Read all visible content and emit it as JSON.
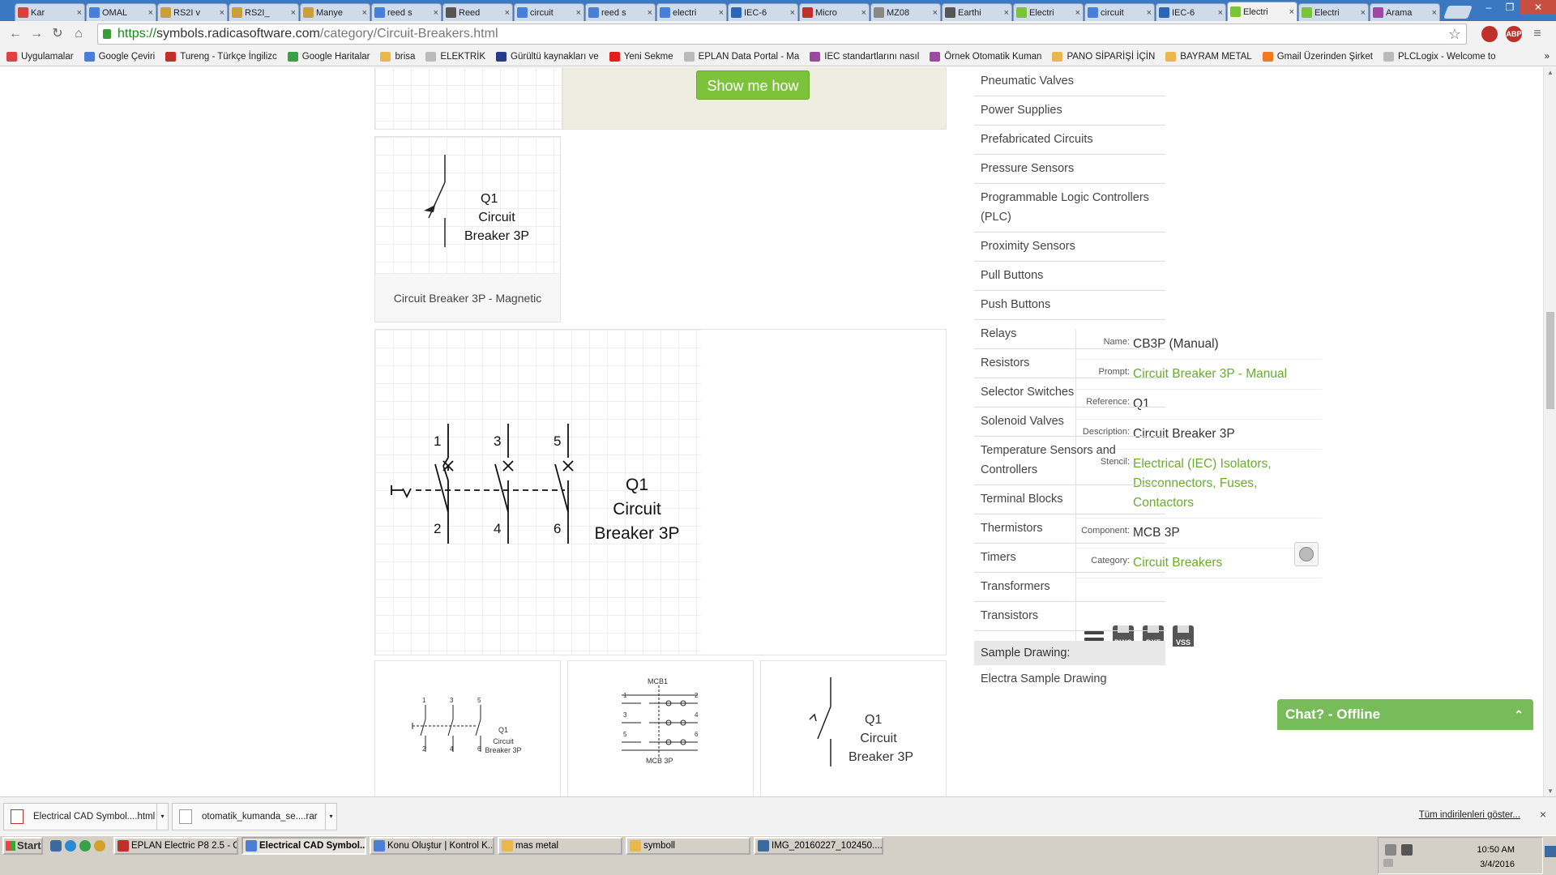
{
  "browser": {
    "tabs": [
      {
        "title": "Kar",
        "icon_color": "#d94040",
        "active": false
      },
      {
        "title": "OMAL",
        "icon_color": "#4a7fd4",
        "active": false
      },
      {
        "title": "RS2I v",
        "icon_color": "#c9a13a",
        "active": false
      },
      {
        "title": "RS2I_",
        "icon_color": "#c9a13a",
        "active": false
      },
      {
        "title": "Manye",
        "icon_color": "#c9a13a",
        "active": false
      },
      {
        "title": "reed s",
        "icon_color": "#4a7fd4",
        "active": false
      },
      {
        "title": "Reed",
        "icon_color": "#555555",
        "active": false
      },
      {
        "title": "circuit",
        "icon_color": "#4a7fd4",
        "active": false
      },
      {
        "title": "reed s",
        "icon_color": "#4a7fd4",
        "active": false
      },
      {
        "title": "electri",
        "icon_color": "#4a7fd4",
        "active": false
      },
      {
        "title": "IEC-6",
        "icon_color": "#2a66b3",
        "active": false
      },
      {
        "title": "Micro",
        "icon_color": "#c0302a",
        "active": false
      },
      {
        "title": "MZ08",
        "icon_color": "#888888",
        "active": false
      },
      {
        "title": "Earthi",
        "icon_color": "#555555",
        "active": false
      },
      {
        "title": "Electri",
        "icon_color": "#7cc23a",
        "active": false
      },
      {
        "title": "circuit",
        "icon_color": "#4a7fd4",
        "active": false
      },
      {
        "title": "IEC-6",
        "icon_color": "#2a66b3",
        "active": false
      },
      {
        "title": "Electri",
        "icon_color": "#7cc23a",
        "active": true
      },
      {
        "title": "Electri",
        "icon_color": "#7cc23a",
        "active": false
      },
      {
        "title": "Arama",
        "icon_color": "#9b4aa0",
        "active": false
      }
    ],
    "tab_close_glyph": "×",
    "url": {
      "scheme": "https://",
      "host": "symbols.radicasoftware.com",
      "path": "/category/Circuit-Breakers.html"
    },
    "extensions": [
      "ABP"
    ],
    "bookmarks": [
      {
        "label": "Uygulamalar",
        "icon": "apps-icon",
        "color": "#e04040"
      },
      {
        "label": "Google Çeviri",
        "icon": "translate-icon",
        "color": "#4a7fd4"
      },
      {
        "label": "Tureng - Türkçe İngilizc",
        "icon": "tureng-icon",
        "color": "#c0302a"
      },
      {
        "label": "Google Haritalar",
        "icon": "maps-icon",
        "color": "#3aa04a"
      },
      {
        "label": "brisa",
        "icon": "folder-icon",
        "color": "#e8b84e"
      },
      {
        "label": "ELEKTRİK",
        "icon": "page-icon",
        "color": "#bbbbbb"
      },
      {
        "label": "Gürültü kaynakları ve",
        "icon": "d-icon",
        "color": "#2a3a8a"
      },
      {
        "label": "Yeni Sekme",
        "icon": "youtube-icon",
        "color": "#e02020"
      },
      {
        "label": "EPLAN Data Portal - Ma",
        "icon": "page-icon",
        "color": "#bbbbbb"
      },
      {
        "label": "IEC standartlarını nasıl",
        "icon": "kk-icon",
        "color": "#9b4aa0"
      },
      {
        "label": "Örnek Otomatik Kuman",
        "icon": "kk-icon",
        "color": "#9b4aa0"
      },
      {
        "label": "PANO SİPARİŞİ İÇİN",
        "icon": "folder-icon",
        "color": "#e8b84e"
      },
      {
        "label": "BAYRAM METAL",
        "icon": "folder-icon",
        "color": "#e8b84e"
      },
      {
        "label": "Gmail Üzerinden Şirket",
        "icon": "blogger-icon",
        "color": "#f07a20"
      },
      {
        "label": "PLCLogix - Welcome to",
        "icon": "page-icon",
        "color": "#bbbbbb"
      }
    ],
    "bookmarks_more": "»"
  },
  "page": {
    "show_me_button": "Show me how",
    "magnetic_card": {
      "symbol_ref": "Q1",
      "symbol_line1": "Circuit",
      "symbol_line2": "Breaker 3P",
      "caption": "Circuit Breaker 3P - Magnetic"
    },
    "detail": {
      "symbol": {
        "poles_top": [
          "1",
          "3",
          "5"
        ],
        "poles_bottom": [
          "2",
          "4",
          "6"
        ],
        "ref": "Q1",
        "line1": "Circuit",
        "line2": "Breaker 3P"
      },
      "fields": [
        {
          "label": "Name:",
          "value": "CB3P (Manual)",
          "link": false
        },
        {
          "label": "Prompt:",
          "value": "Circuit Breaker 3P - Manual",
          "link": true
        },
        {
          "label": "Reference:",
          "value": "Q1",
          "link": false
        },
        {
          "label": "Description:",
          "value": "Circuit Breaker 3P",
          "link": false
        },
        {
          "label": "Stencil:",
          "value": "Electrical (IEC) Isolators, Disconnectors, Fuses, Contactors",
          "link": true
        },
        {
          "label": "Component:",
          "value": "MCB 3P",
          "link": false
        },
        {
          "label": "Category:",
          "value": "Circuit Breakers",
          "link": true
        }
      ],
      "downloads": [
        "DWG",
        "DXF",
        "VSS"
      ]
    },
    "thumbs": [
      {
        "poles_top": [
          "1",
          "3",
          "5"
        ],
        "poles_bottom": [
          "2",
          "4",
          "6"
        ],
        "ref": "Q1",
        "line1": "Circuit",
        "line2": "Breaker 3P"
      },
      {
        "top_label": "MCB1",
        "bottom_label": "MCB 3P",
        "left_nums": [
          "1",
          "3",
          "5"
        ],
        "right_nums": [
          "2",
          "4",
          "6"
        ]
      },
      {
        "ref": "Q1",
        "line1": "Circuit",
        "line2": "Breaker 3P"
      }
    ],
    "sidebar": {
      "items": [
        "Pneumatic Valves",
        "Power Supplies",
        "Prefabricated Circuits",
        "Pressure Sensors",
        "Programmable Logic Controllers (PLC)",
        "Proximity Sensors",
        "Pull Buttons",
        "Push Buttons",
        "Relays",
        "Resistors",
        "Selector Switches",
        "Solenoid Valves",
        "Temperature Sensors and Controllers",
        "Terminal Blocks",
        "Thermistors",
        "Timers",
        "Transformers",
        "Transistors"
      ],
      "sample_heading": "Sample Drawing:",
      "sample_link": "Electra Sample Drawing"
    },
    "chat": {
      "label": "Chat? - Offline",
      "caret": "⌃"
    },
    "accent_color": "#7cc23a"
  },
  "downloads_bar": {
    "items": [
      "Electrical CAD Symbol....html",
      "otomatik_kumanda_se....rar"
    ],
    "show_all": "Tüm indirilenleri göster...",
    "close": "×"
  },
  "taskbar": {
    "start": "Start",
    "tasks": [
      {
        "label": "EPLAN Electric P8 2.5 - C...",
        "color": "#c0302a",
        "active": false
      },
      {
        "label": "Electrical CAD Symbol...",
        "color": "#4a7fd4",
        "active": true
      },
      {
        "label": "Konu Oluştur | Kontrol K...",
        "color": "#4a7fd4",
        "active": false
      },
      {
        "label": "mas metal",
        "color": "#e8b84e",
        "active": false
      },
      {
        "label": "symboll",
        "color": "#e8b84e",
        "active": false
      },
      {
        "label": "IMG_20160227_102450....",
        "color": "#3a6aa0",
        "active": false
      }
    ],
    "time": "10:50 AM",
    "date": "3/4/2016"
  }
}
